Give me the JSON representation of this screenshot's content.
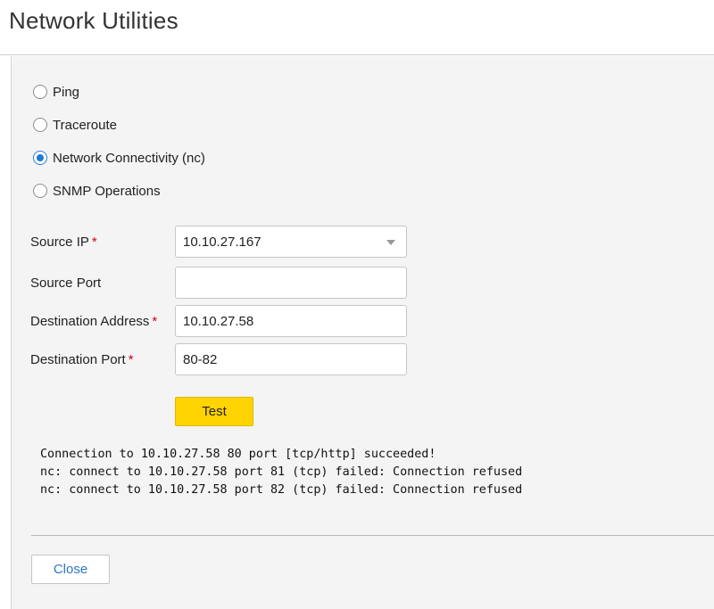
{
  "header": {
    "title": "Network Utilities"
  },
  "tool_options": [
    {
      "label": "Ping",
      "checked": false
    },
    {
      "label": "Traceroute",
      "checked": false
    },
    {
      "label": "Network Connectivity (nc)",
      "checked": true
    },
    {
      "label": "SNMP Operations",
      "checked": false
    }
  ],
  "form": {
    "source_ip": {
      "label": "Source IP",
      "required_marker": "*",
      "value": "10.10.27.167"
    },
    "source_port": {
      "label": "Source Port",
      "value": ""
    },
    "destination_address": {
      "label": "Destination Address",
      "required_marker": "*",
      "value": "10.10.27.58"
    },
    "destination_port": {
      "label": "Destination Port",
      "required_marker": "*",
      "value": "80-82"
    },
    "test_label": "Test"
  },
  "output_lines": [
    "Connection to 10.10.27.58 80 port [tcp/http] succeeded!",
    "nc: connect to 10.10.27.58 port 81 (tcp) failed: Connection refused",
    "nc: connect to 10.10.27.58 port 82 (tcp) failed: Connection refused"
  ],
  "footer": {
    "close_label": "Close"
  },
  "colors": {
    "accent": "#1c7ad6",
    "primary_button": "#ffd400",
    "required": "#d0021b"
  },
  "icons": {
    "select_arrow": "chevron-down-icon"
  }
}
